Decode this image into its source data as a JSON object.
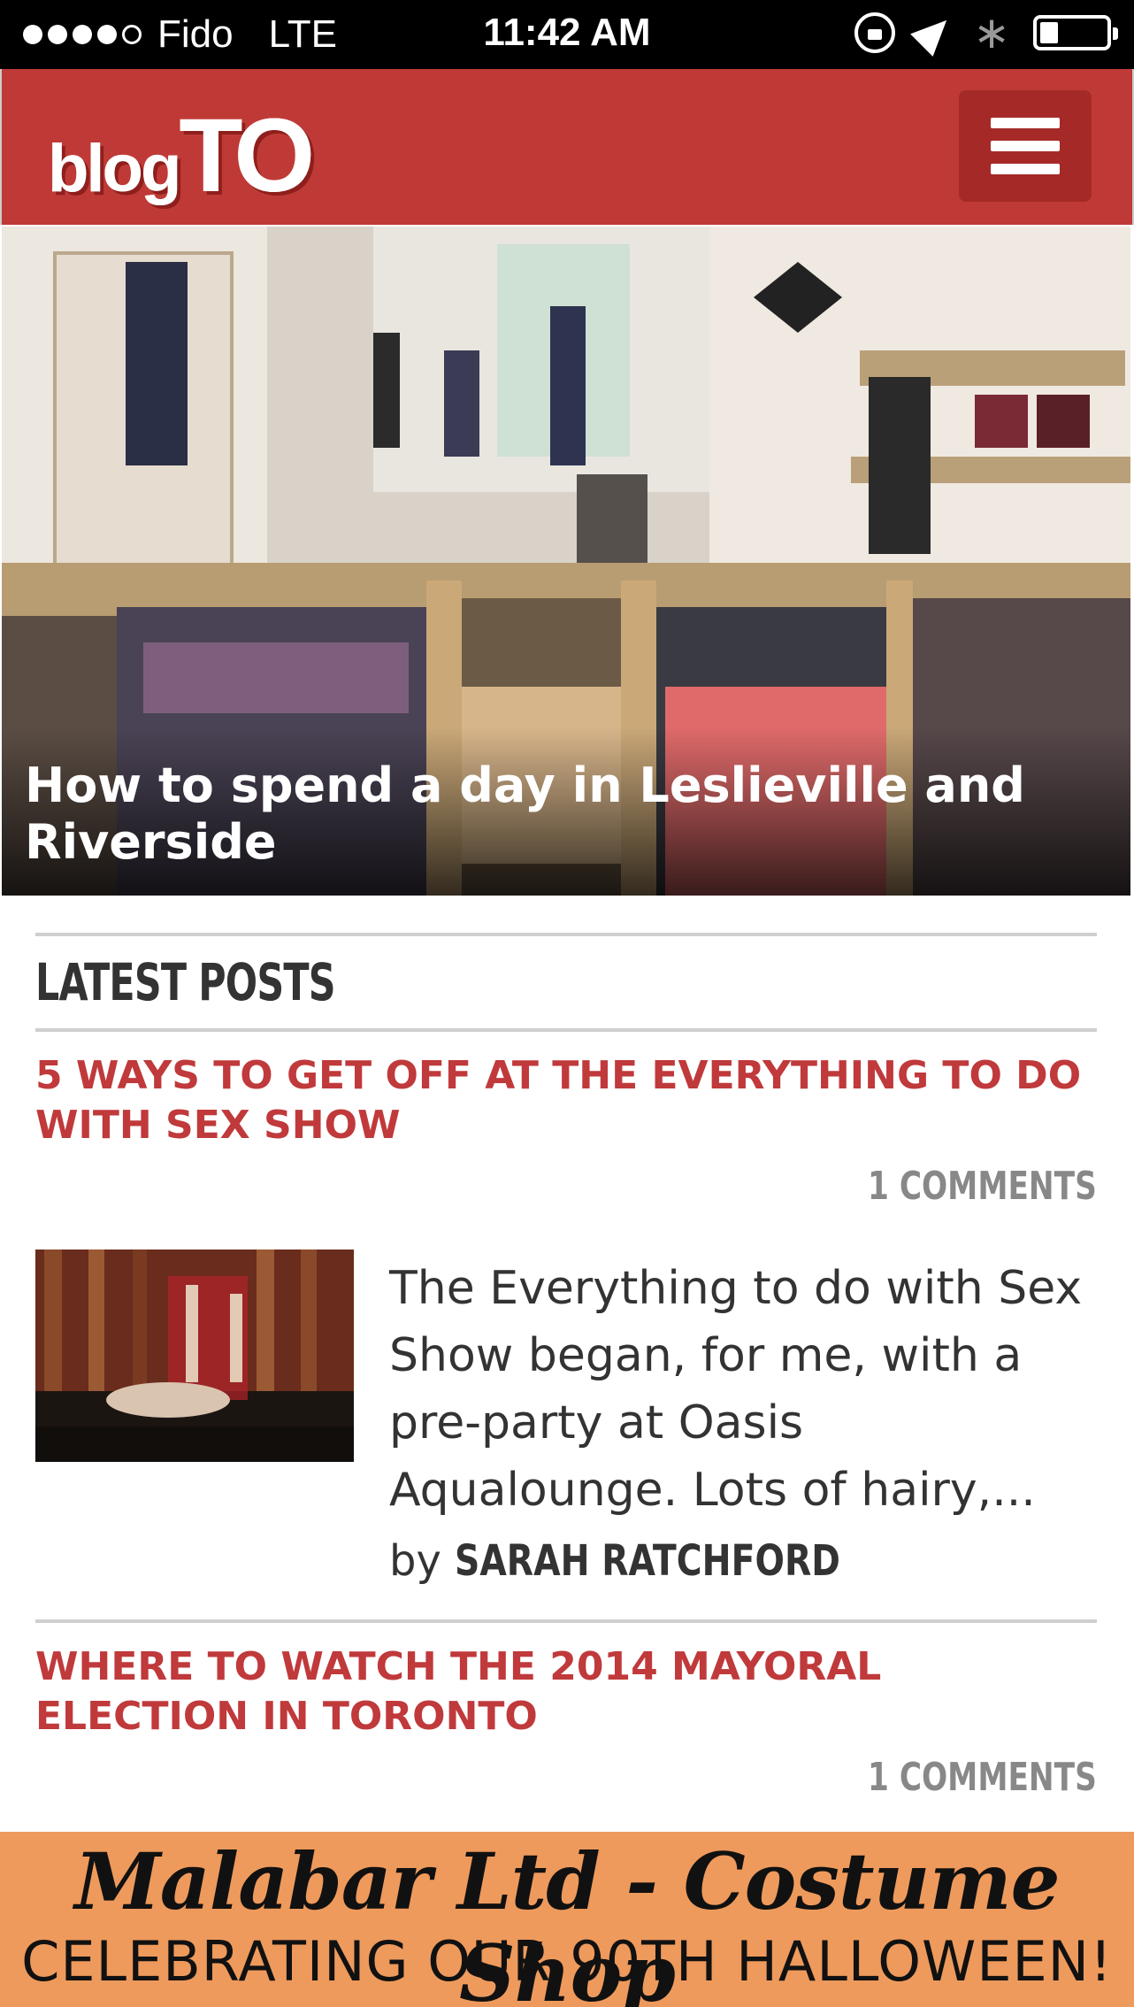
{
  "status_bar": {
    "carrier": "Fido",
    "network": "LTE",
    "time": "11:42 AM",
    "signal_bars": 4,
    "signal_max": 5,
    "bluetooth_glyph": "∗",
    "icons": [
      "orientation-lock-icon",
      "location-icon",
      "bluetooth-icon",
      "battery-icon"
    ]
  },
  "header": {
    "logo_blog": "blog",
    "logo_to": "TO",
    "brand_color": "#bf3a36",
    "menu_icon": "hamburger-icon"
  },
  "hero": {
    "title": "How to spend a day in Leslieville and Riverside"
  },
  "latest": {
    "section_title": "LATEST POSTS",
    "posts": [
      {
        "title": "5 WAYS TO GET OFF AT THE EVERYTHING TO DO WITH SEX SHOW",
        "comments": "1 COMMENTS",
        "excerpt": "The Everything to do with Sex Show began, for me, with a pre-party at Oasis Aqualounge. Lots of hairy,...",
        "by": "by",
        "author": "SARAH RATCHFORD"
      },
      {
        "title": "WHERE TO WATCH THE 2014 MAYORAL ELECTION IN TORONTO",
        "comments": "1 COMMENTS"
      }
    ]
  },
  "ad": {
    "line1": "Malabar Ltd - Costume Shop",
    "line2": "CELEBRATING OUR 90TH HALLOWEEN!",
    "background": "#ee9a5c"
  }
}
